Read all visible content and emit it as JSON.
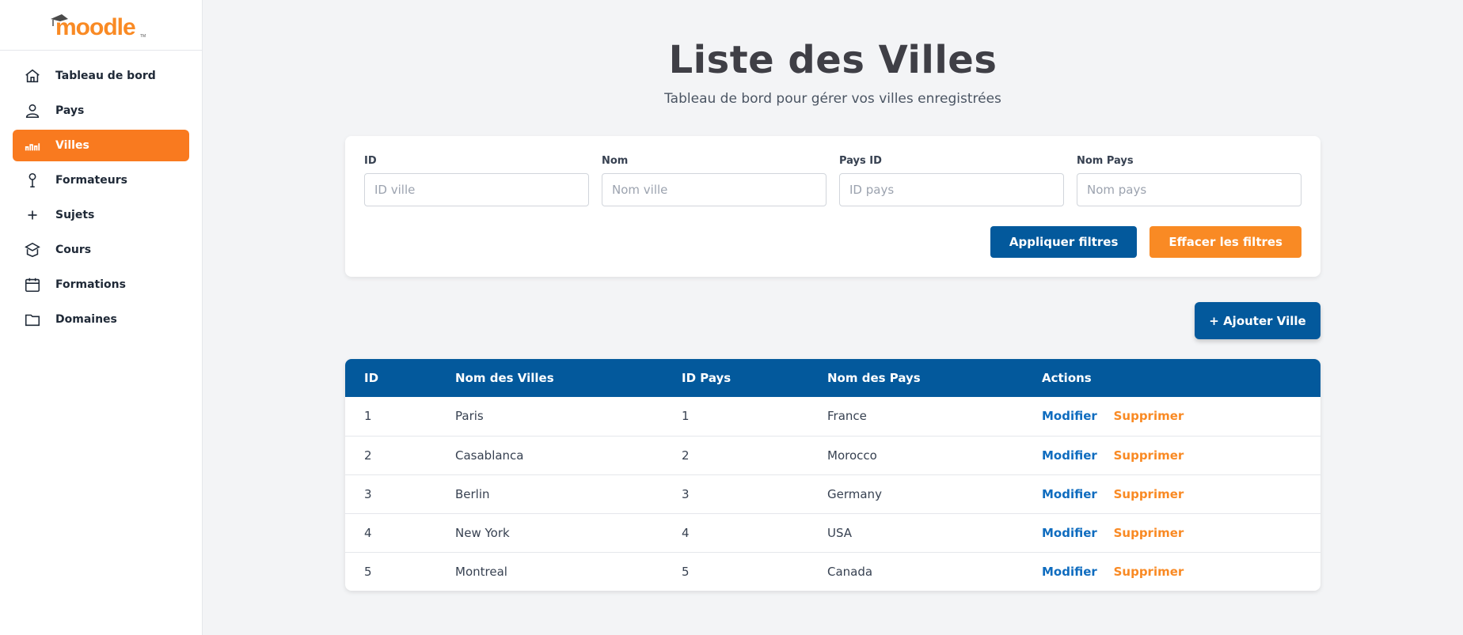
{
  "brand": {
    "logo_text": "moodle",
    "logo_color": "#f98a24"
  },
  "sidebar": {
    "items": [
      {
        "label": "Tableau de bord",
        "icon": "home-icon",
        "active": false
      },
      {
        "label": "Pays",
        "icon": "user-icon",
        "active": false
      },
      {
        "label": "Villes",
        "icon": "chart-icon",
        "active": true
      },
      {
        "label": "Formateurs",
        "icon": "pin-icon",
        "active": false
      },
      {
        "label": "Sujets",
        "icon": "plus-icon",
        "active": false
      },
      {
        "label": "Cours",
        "icon": "box-icon",
        "active": false
      },
      {
        "label": "Formations",
        "icon": "calendar-icon",
        "active": false
      },
      {
        "label": "Domaines",
        "icon": "folder-icon",
        "active": false
      }
    ]
  },
  "header": {
    "title": "Liste des Villes",
    "subtitle": "Tableau de bord pour gérer vos villes enregistrées"
  },
  "filters": {
    "fields": [
      {
        "label": "ID",
        "placeholder": "ID ville",
        "value": ""
      },
      {
        "label": "Nom",
        "placeholder": "Nom ville",
        "value": ""
      },
      {
        "label": "Pays ID",
        "placeholder": "ID pays",
        "value": ""
      },
      {
        "label": "Nom Pays",
        "placeholder": "Nom pays",
        "value": ""
      }
    ],
    "apply_label": "Appliquer filtres",
    "clear_label": "Effacer les filtres"
  },
  "add_button_label": "+ Ajouter Ville",
  "table": {
    "headers": [
      "ID",
      "Nom des Villes",
      "ID Pays",
      "Nom des Pays",
      "Actions"
    ],
    "rows": [
      {
        "id": "1",
        "city": "Paris",
        "country_id": "1",
        "country": "France"
      },
      {
        "id": "2",
        "city": "Casablanca",
        "country_id": "2",
        "country": "Morocco"
      },
      {
        "id": "3",
        "city": "Berlin",
        "country_id": "3",
        "country": "Germany"
      },
      {
        "id": "4",
        "city": "New York",
        "country_id": "4",
        "country": "USA"
      },
      {
        "id": "5",
        "city": "Montreal",
        "country_id": "5",
        "country": "Canada"
      }
    ],
    "edit_label": "Modifier",
    "delete_label": "Supprimer"
  },
  "colors": {
    "primary": "#03599c",
    "accent": "#f98a24",
    "active_nav": "#f97a1f",
    "link": "#0f6cbf"
  }
}
